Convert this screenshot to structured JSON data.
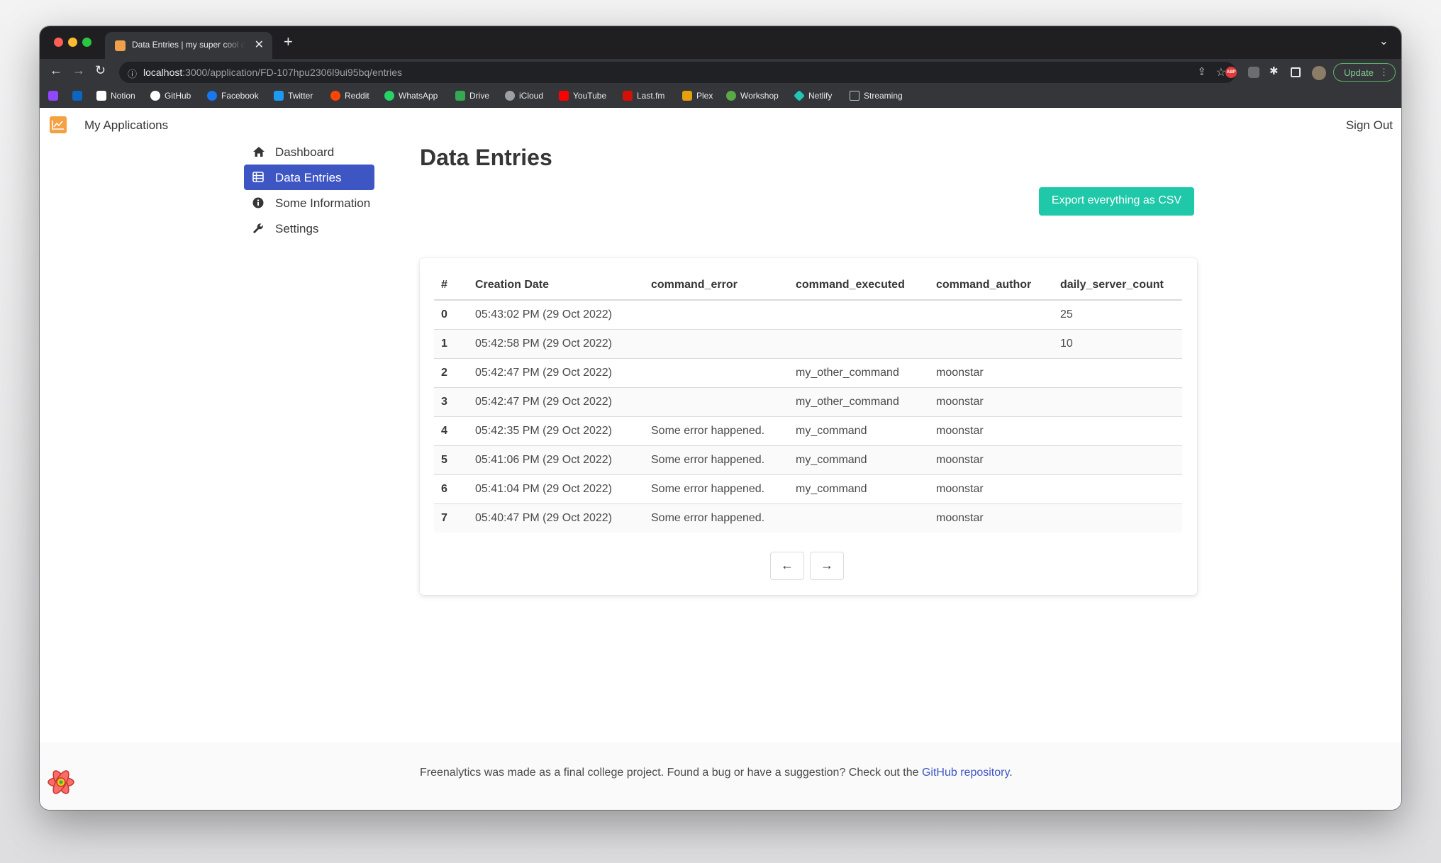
{
  "browser": {
    "tab_title": "Data Entries | my super cool discord bot",
    "tab_close": "✕",
    "new_tab": "+",
    "tab_menu": "⌄",
    "url_host": "localhost",
    "url_path": ":3000/application/FD-107hpu2306l9ui95bq/entries",
    "update_label": "Update",
    "ext_abp": "ABP",
    "bookmarks": [
      {
        "label": "",
        "icon": "twitch-icon",
        "color": "#9146ff"
      },
      {
        "label": "",
        "icon": "linkedin-icon",
        "color": "#0a66c2"
      },
      {
        "label": "Notion",
        "icon": "notion-icon",
        "color": "#ffffff"
      },
      {
        "label": "GitHub",
        "icon": "github-icon",
        "color": "#ffffff"
      },
      {
        "label": "Facebook",
        "icon": "facebook-icon",
        "color": "#1877f2"
      },
      {
        "label": "Twitter",
        "icon": "twitter-icon",
        "color": "#1d9bf0"
      },
      {
        "label": "Reddit",
        "icon": "reddit-icon",
        "color": "#ff4500"
      },
      {
        "label": "WhatsApp",
        "icon": "whatsapp-icon",
        "color": "#25d366"
      },
      {
        "label": "Drive",
        "icon": "drive-icon",
        "color": "#34a853"
      },
      {
        "label": "iCloud",
        "icon": "apple-icon",
        "color": "#9aa0a6"
      },
      {
        "label": "YouTube",
        "icon": "youtube-icon",
        "color": "#ff0000"
      },
      {
        "label": "Last.fm",
        "icon": "lastfm-icon",
        "color": "#d51007"
      },
      {
        "label": "Plex",
        "icon": "plex-icon",
        "color": "#e5a00d"
      },
      {
        "label": "Workshop",
        "icon": "workshop-icon",
        "color": "#5aa846"
      },
      {
        "label": "Netlify",
        "icon": "netlify-icon",
        "color": "#20c6b7"
      },
      {
        "label": "Streaming",
        "icon": "folder-icon",
        "color": "#bdc1c6"
      }
    ]
  },
  "navbar": {
    "brand": "My Applications",
    "sign_out": "Sign Out"
  },
  "sidebar": {
    "items": [
      {
        "label": "Dashboard",
        "icon": "home-icon",
        "active": false
      },
      {
        "label": "Data Entries",
        "icon": "table-icon",
        "active": true
      },
      {
        "label": "Some Information",
        "icon": "info-icon",
        "active": false
      },
      {
        "label": "Settings",
        "icon": "wrench-icon",
        "active": false
      }
    ]
  },
  "main": {
    "title": "Data Entries",
    "export_label": "Export everything as CSV",
    "table": {
      "columns": [
        "#",
        "Creation Date",
        "command_error",
        "command_executed",
        "command_author",
        "daily_server_count"
      ],
      "rows": [
        [
          "0",
          "05:43:02 PM (29 Oct 2022)",
          "",
          "",
          "",
          "25"
        ],
        [
          "1",
          "05:42:58 PM (29 Oct 2022)",
          "",
          "",
          "",
          "10"
        ],
        [
          "2",
          "05:42:47 PM (29 Oct 2022)",
          "",
          "my_other_command",
          "moonstar",
          ""
        ],
        [
          "3",
          "05:42:47 PM (29 Oct 2022)",
          "",
          "my_other_command",
          "moonstar",
          ""
        ],
        [
          "4",
          "05:42:35 PM (29 Oct 2022)",
          "Some error happened.",
          "my_command",
          "moonstar",
          ""
        ],
        [
          "5",
          "05:41:06 PM (29 Oct 2022)",
          "Some error happened.",
          "my_command",
          "moonstar",
          ""
        ],
        [
          "6",
          "05:41:04 PM (29 Oct 2022)",
          "Some error happened.",
          "my_command",
          "moonstar",
          ""
        ],
        [
          "7",
          "05:40:47 PM (29 Oct 2022)",
          "Some error happened.",
          "",
          "moonstar",
          ""
        ]
      ]
    },
    "pager": {
      "prev": "←",
      "next": "→"
    }
  },
  "footer": {
    "text_before": "Freenalytics was made as a final college project. Found a bug or have a suggestion? Check out the ",
    "link_label": "GitHub repository",
    "text_after": "."
  },
  "colors": {
    "primary": "#3e56c4",
    "accent": "#1fc8a8",
    "logo": "#f5a142"
  }
}
